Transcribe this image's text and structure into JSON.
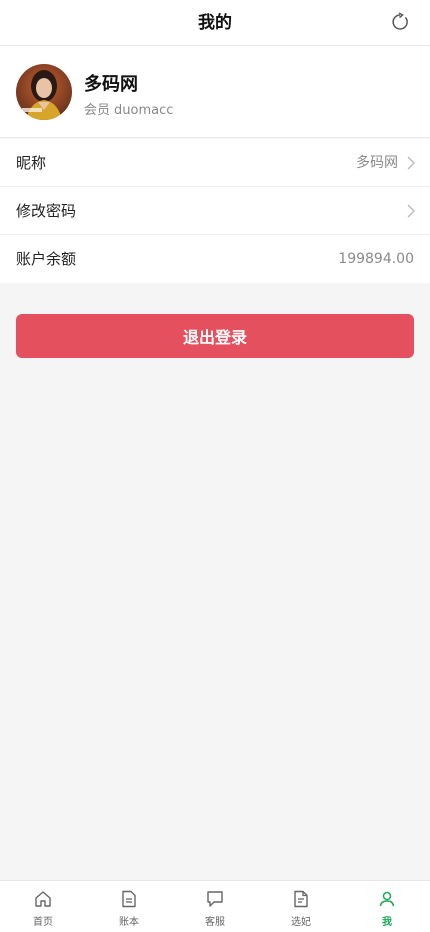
{
  "header": {
    "title": "我的"
  },
  "profile": {
    "name": "多码网",
    "role": "会员",
    "username": "duomacc"
  },
  "list": [
    {
      "label": "昵称",
      "value": "多码网"
    },
    {
      "label": "修改密码",
      "value": ""
    },
    {
      "label": "账户余额",
      "value": "199894.00"
    }
  ],
  "logout_label": "退出登录",
  "tabbar": [
    {
      "label": "首页",
      "icon": "home-icon"
    },
    {
      "label": "账本",
      "icon": "document-icon"
    },
    {
      "label": "客服",
      "icon": "chat-icon"
    },
    {
      "label": "选妃",
      "icon": "file-list-icon"
    },
    {
      "label": "我",
      "icon": "user-icon"
    }
  ],
  "colors": {
    "accent": "#1fa85a",
    "logout": "#e5505e",
    "background": "#f5f5f5"
  }
}
